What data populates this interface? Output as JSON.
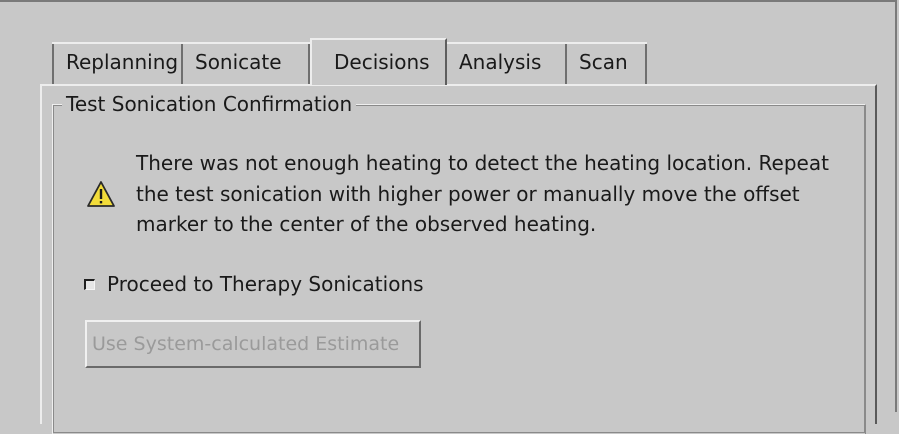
{
  "tabs": [
    {
      "label": "Replanning",
      "selected": false
    },
    {
      "label": "Sonicate",
      "selected": false
    },
    {
      "label": "Decisions",
      "selected": true
    },
    {
      "label": "Analysis",
      "selected": false
    },
    {
      "label": "Scan",
      "selected": false
    }
  ],
  "group": {
    "title": "Test Sonication Confirmation"
  },
  "warning": {
    "icon": "warning-triangle",
    "text": "There was not enough heating to detect the heating location. Repeat\nthe test sonication with higher power or manually move the offset\nmarker to the center of the observed heating."
  },
  "checkbox": {
    "label": "Proceed to Therapy Sonications",
    "checked": false
  },
  "button": {
    "label": "Use System-calculated Estimate",
    "enabled": false
  },
  "colors": {
    "background": "#c8c8c8",
    "warning_fill": "#f2dc3a",
    "disabled_text": "#9a9a9a"
  }
}
